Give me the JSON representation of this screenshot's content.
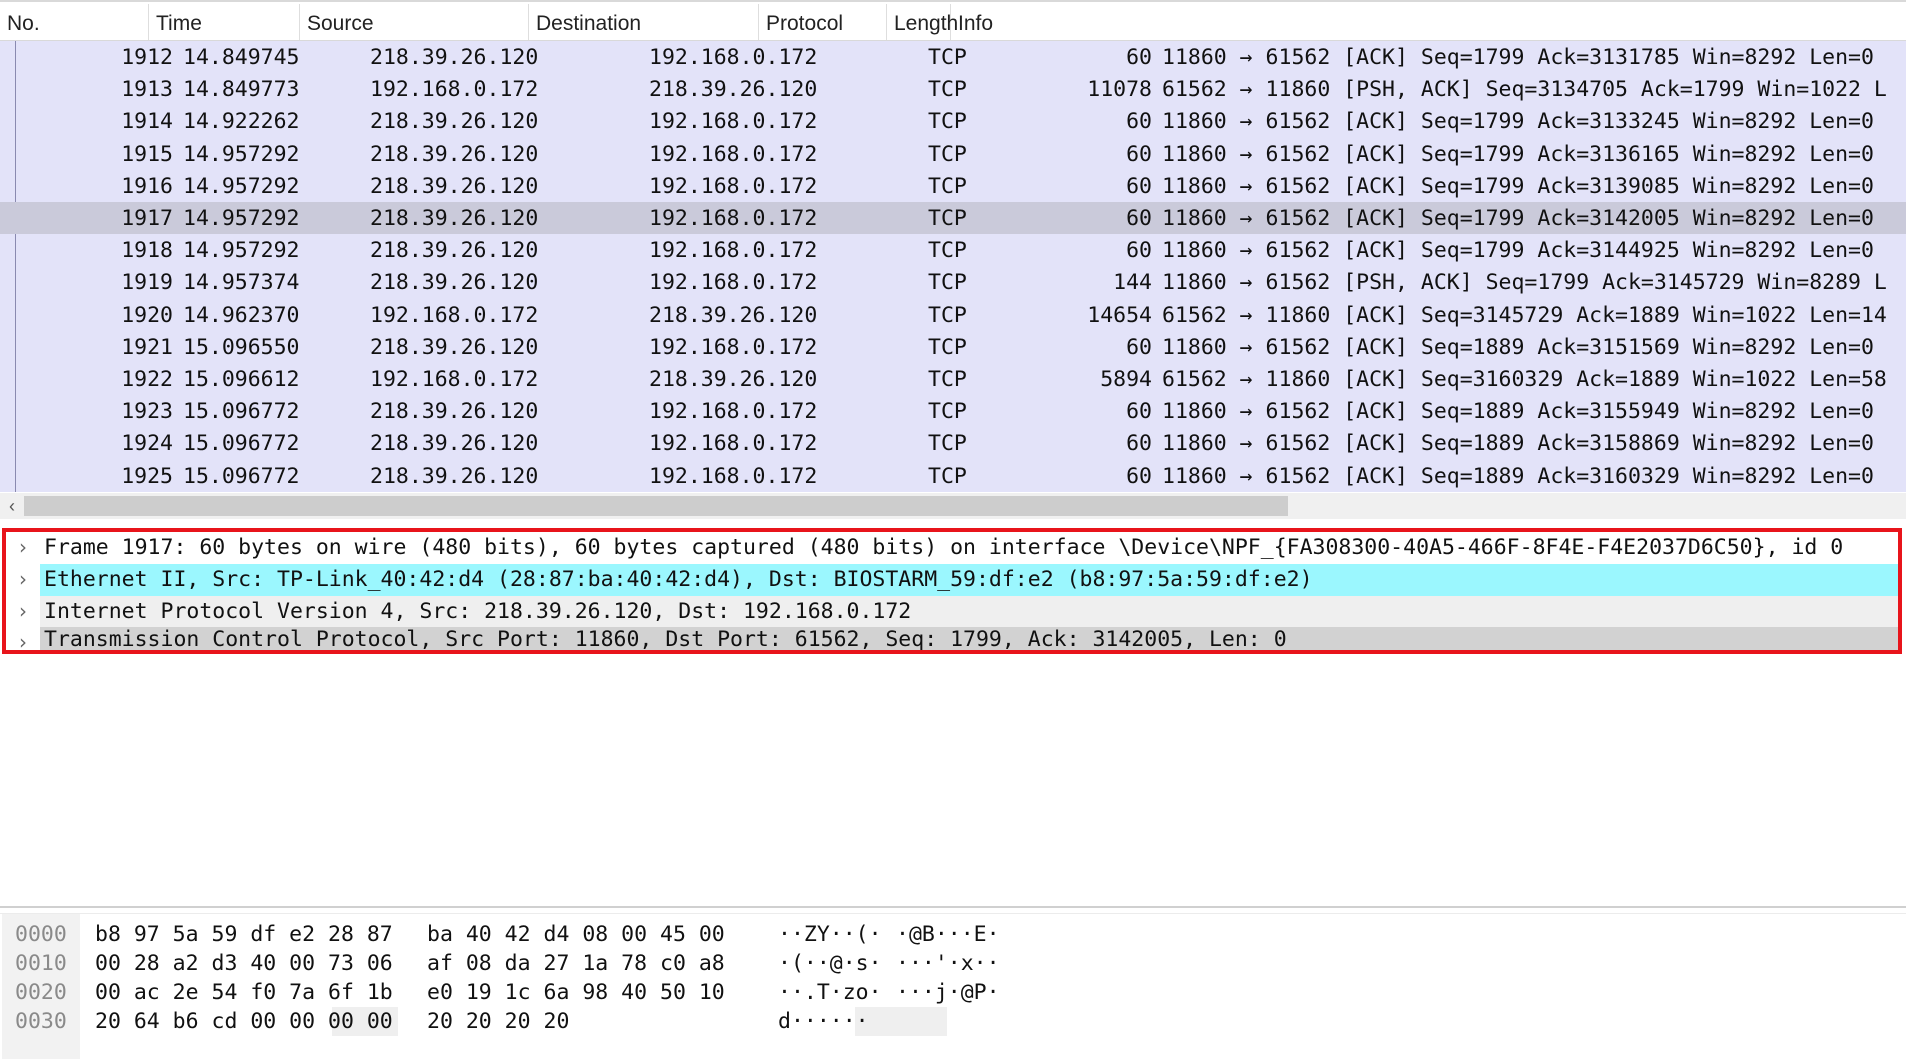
{
  "packet_list": {
    "columns": [
      "No.",
      "Time",
      "Source",
      "Destination",
      "Protocol",
      "Length",
      "Info"
    ],
    "rows": [
      {
        "no": "1912",
        "time": "14.849745",
        "src": "218.39.26.120",
        "dst": "192.168.0.172",
        "proto": "TCP",
        "len": "60",
        "info": "11860 → 61562 [ACK] Seq=1799 Ack=3131785 Win=8292 Len=0"
      },
      {
        "no": "1913",
        "time": "14.849773",
        "src": "192.168.0.172",
        "dst": "218.39.26.120",
        "proto": "TCP",
        "len": "11078",
        "info": "61562 → 11860 [PSH, ACK] Seq=3134705 Ack=1799 Win=1022 L"
      },
      {
        "no": "1914",
        "time": "14.922262",
        "src": "218.39.26.120",
        "dst": "192.168.0.172",
        "proto": "TCP",
        "len": "60",
        "info": "11860 → 61562 [ACK] Seq=1799 Ack=3133245 Win=8292 Len=0"
      },
      {
        "no": "1915",
        "time": "14.957292",
        "src": "218.39.26.120",
        "dst": "192.168.0.172",
        "proto": "TCP",
        "len": "60",
        "info": "11860 → 61562 [ACK] Seq=1799 Ack=3136165 Win=8292 Len=0"
      },
      {
        "no": "1916",
        "time": "14.957292",
        "src": "218.39.26.120",
        "dst": "192.168.0.172",
        "proto": "TCP",
        "len": "60",
        "info": "11860 → 61562 [ACK] Seq=1799 Ack=3139085 Win=8292 Len=0"
      },
      {
        "no": "1917",
        "time": "14.957292",
        "src": "218.39.26.120",
        "dst": "192.168.0.172",
        "proto": "TCP",
        "len": "60",
        "info": "11860 → 61562 [ACK] Seq=1799 Ack=3142005 Win=8292 Len=0",
        "selected": true
      },
      {
        "no": "1918",
        "time": "14.957292",
        "src": "218.39.26.120",
        "dst": "192.168.0.172",
        "proto": "TCP",
        "len": "60",
        "info": "11860 → 61562 [ACK] Seq=1799 Ack=3144925 Win=8292 Len=0"
      },
      {
        "no": "1919",
        "time": "14.957374",
        "src": "218.39.26.120",
        "dst": "192.168.0.172",
        "proto": "TCP",
        "len": "144",
        "info": "11860 → 61562 [PSH, ACK] Seq=1799 Ack=3145729 Win=8289 L"
      },
      {
        "no": "1920",
        "time": "14.962370",
        "src": "192.168.0.172",
        "dst": "218.39.26.120",
        "proto": "TCP",
        "len": "14654",
        "info": "61562 → 11860 [ACK] Seq=3145729 Ack=1889 Win=1022 Len=14"
      },
      {
        "no": "1921",
        "time": "15.096550",
        "src": "218.39.26.120",
        "dst": "192.168.0.172",
        "proto": "TCP",
        "len": "60",
        "info": "11860 → 61562 [ACK] Seq=1889 Ack=3151569 Win=8292 Len=0"
      },
      {
        "no": "1922",
        "time": "15.096612",
        "src": "192.168.0.172",
        "dst": "218.39.26.120",
        "proto": "TCP",
        "len": "5894",
        "info": "61562 → 11860 [ACK] Seq=3160329 Ack=1889 Win=1022 Len=58"
      },
      {
        "no": "1923",
        "time": "15.096772",
        "src": "218.39.26.120",
        "dst": "192.168.0.172",
        "proto": "TCP",
        "len": "60",
        "info": "11860 → 61562 [ACK] Seq=1889 Ack=3155949 Win=8292 Len=0"
      },
      {
        "no": "1924",
        "time": "15.096772",
        "src": "218.39.26.120",
        "dst": "192.168.0.172",
        "proto": "TCP",
        "len": "60",
        "info": "11860 → 61562 [ACK] Seq=1889 Ack=3158869 Win=8292 Len=0"
      },
      {
        "no": "1925",
        "time": "15.096772",
        "src": "218.39.26.120",
        "dst": "192.168.0.172",
        "proto": "TCP",
        "len": "60",
        "info": "11860 → 61562 [ACK] Seq=1889 Ack=3160329 Win=8292 Len=0"
      }
    ],
    "scroll_left_icon": "chevron-left-icon",
    "scroll_left_glyph": "‹"
  },
  "details": {
    "chevron_glyph": "›",
    "items": [
      "Frame 1917: 60 bytes on wire (480 bits), 60 bytes captured (480 bits) on interface \\Device\\NPF_{FA308300-40A5-466F-8F4E-F4E2037D6C50}, id 0",
      "Ethernet II, Src: TP-Link_40:42:d4 (28:87:ba:40:42:d4), Dst: BIOSTARM_59:df:e2 (b8:97:5a:59:df:e2)",
      "Internet Protocol Version 4, Src: 218.39.26.120, Dst: 192.168.0.172",
      "Transmission Control Protocol, Src Port: 11860, Dst Port: 61562, Seq: 1799, Ack: 3142005, Len: 0"
    ],
    "highlight_color": "#e8141b"
  },
  "bytes": {
    "lines": [
      {
        "offset": "0000",
        "hex1": "b8 97 5a 59 df e2 28 87",
        "hex2": "ba 40 42 d4 08 00 45 00",
        "ascii1": "··ZY··(·",
        "ascii2": "·@B···E·"
      },
      {
        "offset": "0010",
        "hex1": "00 28 a2 d3 40 00 73 06",
        "hex2": "af 08 da 27 1a 78 c0 a8",
        "ascii1": "·(··@·s·",
        "ascii2": "···'·x··"
      },
      {
        "offset": "0020",
        "hex1": "00 ac 2e 54 f0 7a 6f 1b",
        "hex2": "e0 19 1c 6a 98 40 50 10",
        "ascii1": "··.T·zo·",
        "ascii2": "···j·@P·"
      },
      {
        "offset": "0030",
        "hex1": "20 64 b6 cd 00 00 00 00",
        "hex2": "20 20 20 20",
        "ascii1": " d······",
        "ascii2": "    "
      }
    ]
  }
}
